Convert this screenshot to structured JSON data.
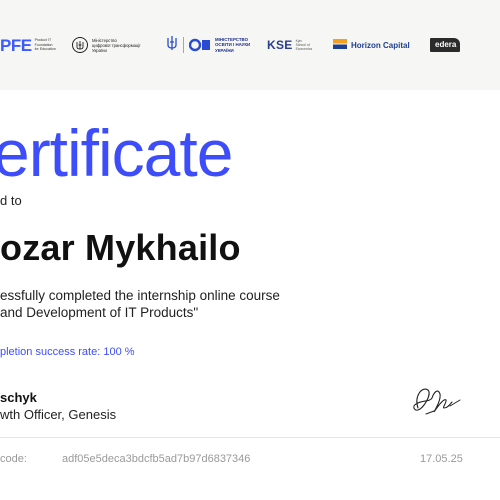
{
  "logos": {
    "pfe": {
      "mark": "PFE",
      "text": "Product IT\nFoundation\nfor Education"
    },
    "mdt": {
      "text": "Міністерство\nцифрової трансформації\nУкраїни"
    },
    "mon": {
      "text": "МІНІСТЕРСТВО\nОСВІТИ І НАУКИ\nУКРАЇНИ"
    },
    "kse": {
      "mark": "KSE",
      "text": "Kyiv\nSchool of\nEconomics"
    },
    "horizon": {
      "text": "Horizon Capital"
    },
    "edera": {
      "text": "edera"
    }
  },
  "certificate": {
    "title": "ertificate",
    "awarded_to": "d to",
    "recipient": "ozar Mykhailo",
    "course_line_1": "essfully completed the internship online course",
    "course_line_2": "and Development of IT Products\"",
    "success_rate": "pletion success rate: 100 %"
  },
  "signer": {
    "name": "schyk",
    "role": "wth Officer, Genesis"
  },
  "footer": {
    "code_label": "code:",
    "code_value": "adf05e5deca3bdcfb5ad7b97d6837346",
    "date": "17.05.25"
  },
  "colors": {
    "accent": "#3d4dfa",
    "logo_bar_bg": "#f6f6f4",
    "text_dark": "#111111",
    "muted": "#9a9a9a"
  }
}
